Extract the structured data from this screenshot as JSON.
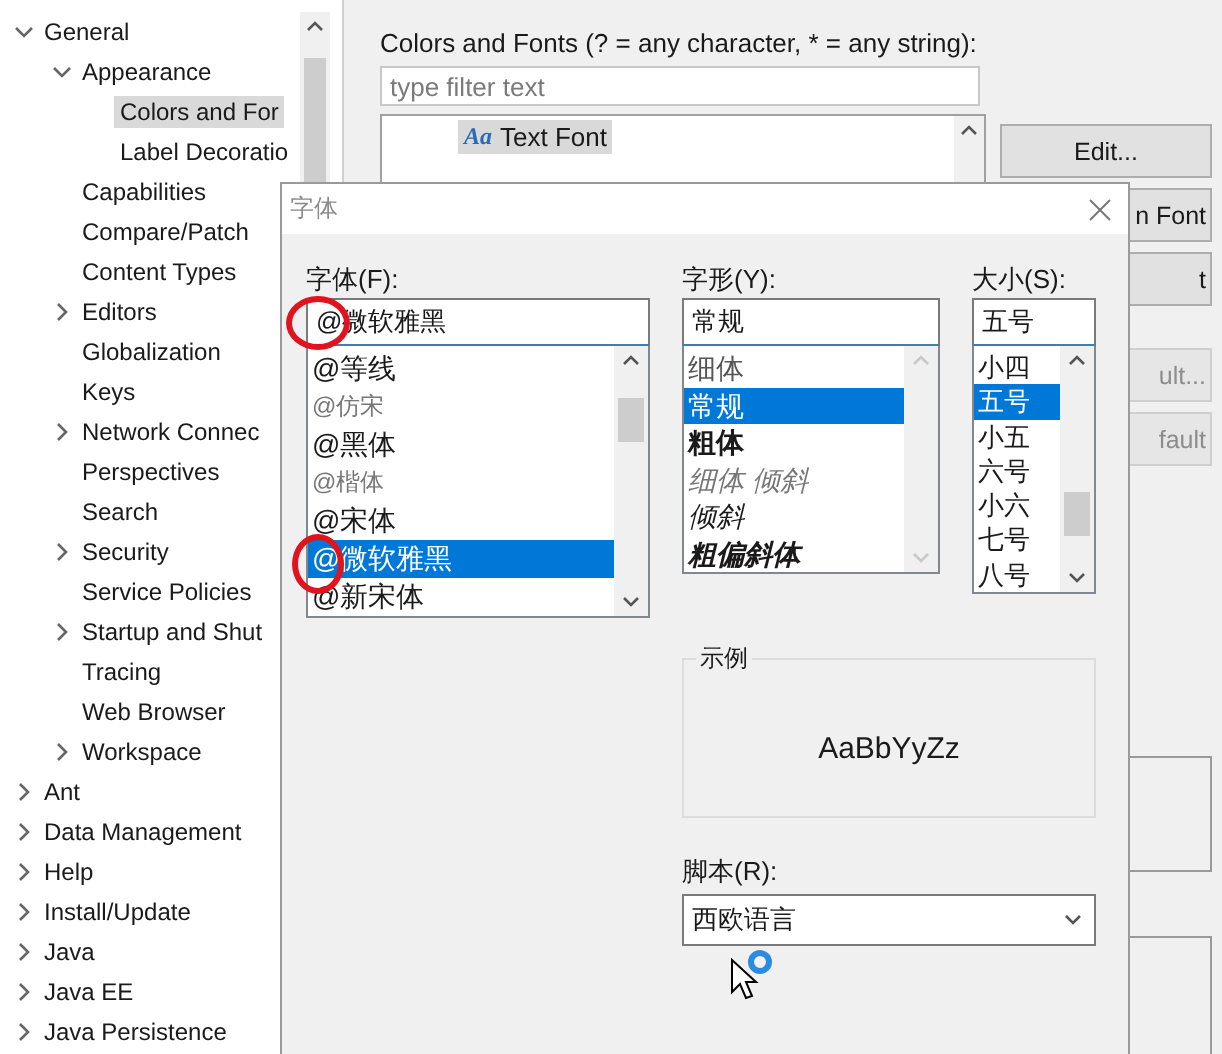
{
  "preferences": {
    "tree": [
      {
        "label": "General",
        "expanded": true,
        "selected": false,
        "children": [
          {
            "label": "Appearance",
            "expanded": true,
            "selected": false,
            "children": [
              {
                "label": "Colors and For",
                "selected": true
              },
              {
                "label": "Label Decoratio",
                "selected": false
              }
            ]
          },
          {
            "label": "Capabilities",
            "selected": false
          },
          {
            "label": "Compare/Patch",
            "selected": false
          },
          {
            "label": "Content Types",
            "selected": false
          },
          {
            "label": "Editors",
            "expanded": false,
            "selected": false
          },
          {
            "label": "Globalization",
            "selected": false
          },
          {
            "label": "Keys",
            "selected": false
          },
          {
            "label": "Network Connec",
            "expanded": false,
            "selected": false
          },
          {
            "label": "Perspectives",
            "selected": false
          },
          {
            "label": "Search",
            "selected": false
          },
          {
            "label": "Security",
            "expanded": false,
            "selected": false
          },
          {
            "label": "Service Policies",
            "selected": false
          },
          {
            "label": "Startup and Shut",
            "expanded": false,
            "selected": false
          },
          {
            "label": "Tracing",
            "selected": false
          },
          {
            "label": "Web Browser",
            "selected": false
          },
          {
            "label": "Workspace",
            "expanded": false,
            "selected": false
          }
        ]
      },
      {
        "label": "Ant",
        "expanded": false,
        "selected": false
      },
      {
        "label": "Data Management",
        "expanded": false,
        "selected": false
      },
      {
        "label": "Help",
        "expanded": false,
        "selected": false
      },
      {
        "label": "Install/Update",
        "expanded": false,
        "selected": false
      },
      {
        "label": "Java",
        "expanded": false,
        "selected": false
      },
      {
        "label": "Java EE",
        "expanded": false,
        "selected": false
      },
      {
        "label": "Java Persistence",
        "expanded": false,
        "selected": false
      }
    ]
  },
  "colors_and_fonts": {
    "heading": "Colors and Fonts (? = any character, * = any string):",
    "filter": {
      "placeholder": "type filter text"
    },
    "items": [
      {
        "icon": "Aa",
        "label": "Text Font",
        "selected": true
      }
    ],
    "buttons": [
      {
        "label": "Edit...",
        "disabled": false
      },
      {
        "label": "n Font",
        "disabled": false
      },
      {
        "label": "t",
        "disabled": false
      },
      {
        "label": "ult...",
        "disabled": true
      },
      {
        "label": "fault",
        "disabled": true
      }
    ]
  },
  "font_dialog": {
    "title": "字体",
    "font": {
      "label": "字体(F):",
      "value": "@微软雅黑",
      "options": [
        {
          "label": "@等线",
          "kind": "normal",
          "selected": false
        },
        {
          "label": "@仿宋",
          "kind": "dim",
          "selected": false
        },
        {
          "label": "@黑体",
          "kind": "normal",
          "selected": false
        },
        {
          "label": "@楷体",
          "kind": "dim",
          "selected": false
        },
        {
          "label": "@宋体",
          "kind": "normal",
          "selected": false
        },
        {
          "label": "@微软雅黑",
          "kind": "normal",
          "selected": true
        },
        {
          "label": "@新宋体",
          "kind": "normal",
          "selected": false
        }
      ]
    },
    "style": {
      "label": "字形(Y):",
      "value": "常规",
      "options": [
        {
          "label": "细体",
          "kind": "light",
          "selected": false
        },
        {
          "label": "常规",
          "kind": "regular",
          "selected": true
        },
        {
          "label": "粗体",
          "kind": "bold",
          "selected": false
        },
        {
          "label": "细体 倾斜",
          "kind": "light-italic",
          "selected": false
        },
        {
          "label": "倾斜",
          "kind": "italic",
          "selected": false
        },
        {
          "label": "粗偏斜体",
          "kind": "bold-italic",
          "selected": false
        }
      ]
    },
    "size": {
      "label": "大小(S):",
      "value": "五号",
      "options": [
        {
          "label": "小四",
          "selected": false
        },
        {
          "label": "五号",
          "selected": true
        },
        {
          "label": "小五",
          "selected": false
        },
        {
          "label": "六号",
          "selected": false
        },
        {
          "label": "小六",
          "selected": false
        },
        {
          "label": "七号",
          "selected": false
        },
        {
          "label": "八号",
          "selected": false
        }
      ]
    },
    "sample": {
      "legend": "示例",
      "text": "AaBbYyZz"
    },
    "script": {
      "label": "脚本(R):",
      "value": "西欧语言"
    }
  }
}
